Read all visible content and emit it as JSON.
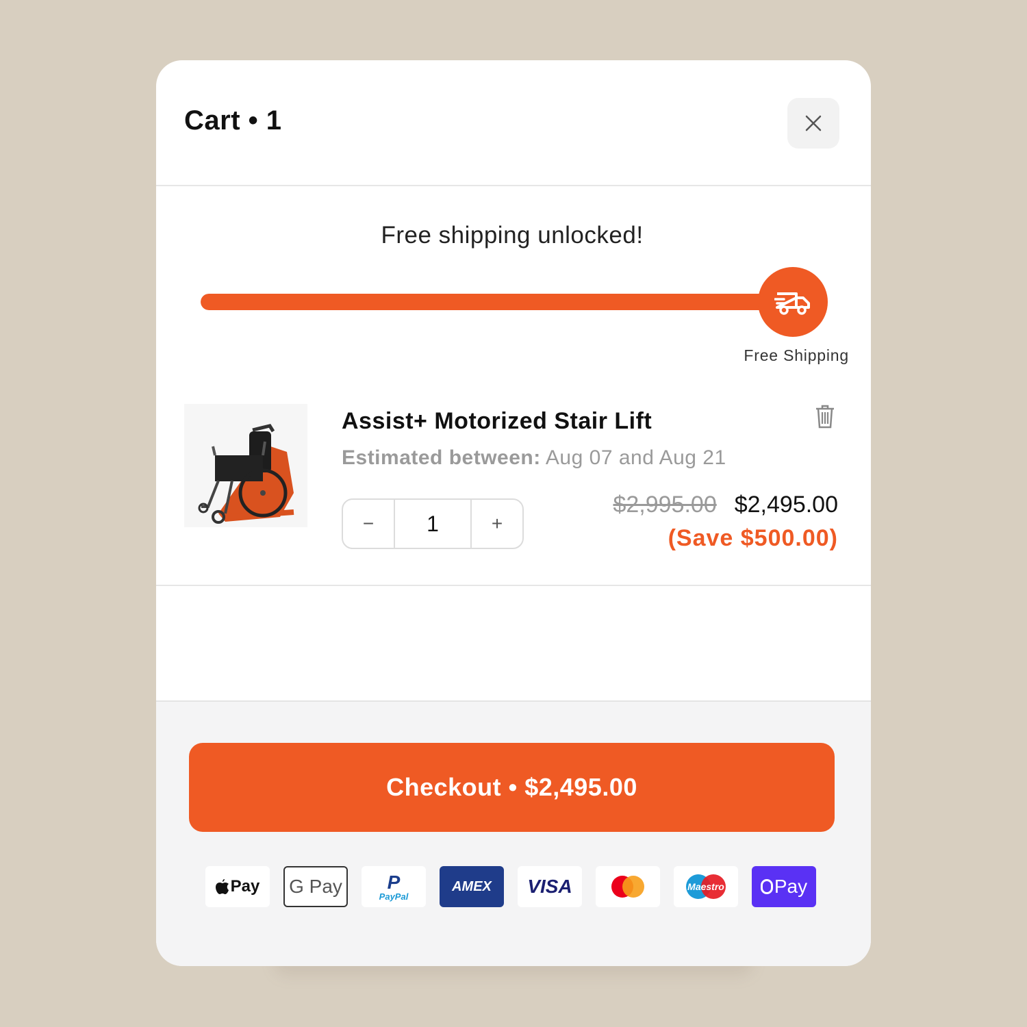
{
  "cart": {
    "title": "Cart • 1",
    "close_icon": "close-icon"
  },
  "shipping": {
    "message": "Free shipping unlocked!",
    "progress": 1.0,
    "milestone_label": "Free Shipping",
    "milestone_icon": "truck-icon",
    "accent_color": "#ef5a24"
  },
  "item": {
    "name": "Assist+ Motorized Stair Lift",
    "estimate_label": "Estimated between:",
    "estimate_value": "Aug 07 and Aug 21",
    "quantity": "1",
    "decrement_label": "−",
    "increment_label": "+",
    "original_price": "$2,995.00",
    "price": "$2,495.00",
    "savings": "(Save $500.00)",
    "remove_icon": "trash-icon",
    "image_icon": "wheelchair-stair-lift-image"
  },
  "checkout": {
    "label": "Checkout • $2,495.00"
  },
  "payment_methods": {
    "apple": "Pay",
    "google": "G Pay",
    "paypal_mark": "P",
    "paypal_text": "PayPal",
    "amex": "AMEX",
    "visa": "VISA",
    "mastercard": "mastercard-icon",
    "maestro": "Maestro",
    "shop": "Pay"
  }
}
